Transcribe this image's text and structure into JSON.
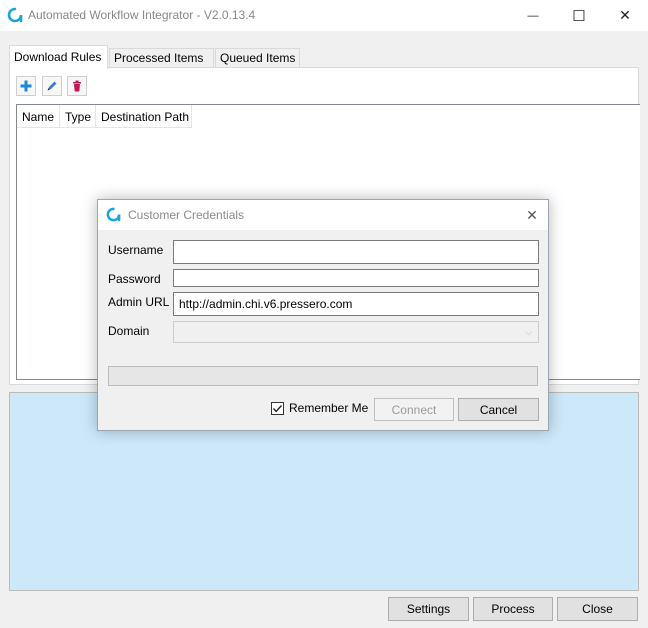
{
  "window": {
    "title": "Automated Workflow Integrator - V2.0.13.4",
    "minimize_icon": "—",
    "maximize_icon": "☐",
    "close_icon": "✕"
  },
  "tabs": [
    {
      "label": "Download Rules",
      "active": true
    },
    {
      "label": "Processed Items",
      "active": false
    },
    {
      "label": "Queued Items",
      "active": false
    }
  ],
  "toolbar": {
    "buttons": [
      {
        "name": "add",
        "icon": "plus-icon",
        "color": "#1e88d8"
      },
      {
        "name": "edit",
        "icon": "pencil-icon",
        "color": "#3a7bd5"
      },
      {
        "name": "delete",
        "icon": "trash-icon",
        "color": "#c2185b"
      }
    ]
  },
  "grid": {
    "columns": [
      "Name",
      "Type",
      "Destination Path"
    ],
    "rows": []
  },
  "log": {
    "background": "#cce8f9"
  },
  "footer": {
    "settings_label": "Settings",
    "process_label": "Process",
    "close_label": "Close"
  },
  "dialog": {
    "title": "Customer Credentials",
    "close_icon": "✕",
    "username_label": "Username",
    "username_value": "",
    "password_label": "Password",
    "password_value": "",
    "admin_url_label": "Admin URL",
    "admin_url_value": "http://admin.chi.v6.pressero.com",
    "domain_label": "Domain",
    "domain_value": "",
    "progress": 0,
    "remember_label": "Remember Me",
    "remember_checked": true,
    "connect_label": "Connect",
    "cancel_label": "Cancel"
  },
  "colors": {
    "brand_accent": "#1aa3e0",
    "selection_panel": "#cce8f9"
  }
}
